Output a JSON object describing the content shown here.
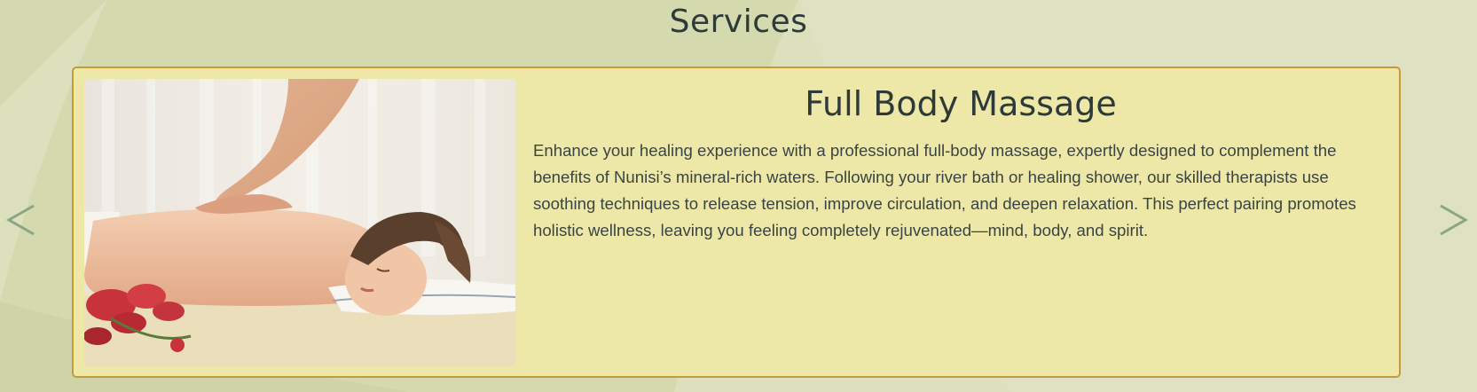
{
  "section": {
    "title": "Services"
  },
  "carousel": {
    "prev_icon": "chevron-left-icon",
    "next_icon": "chevron-right-icon",
    "arrow_color": "#8aa684"
  },
  "slide": {
    "title": "Full Body Massage",
    "description": "Enhance your healing experience with a professional full-body massage, expertly designed to complement the benefits of Nunisi’s mineral-rich waters. Following your river bath or healing shower, our skilled therapists use soothing techniques to release tension, improve circulation, and deepen relaxation. This perfect pairing promotes holistic wellness, leaving you feeling completely rejuvenated—mind, body, and spirit.",
    "image_subject": "woman receiving back massage with red orchids"
  },
  "colors": {
    "background": "#dce0bd",
    "card_background": "#ede8a8",
    "card_border": "#c59a3a",
    "heading": "#2e3a3a",
    "body_text": "#3b4444"
  }
}
